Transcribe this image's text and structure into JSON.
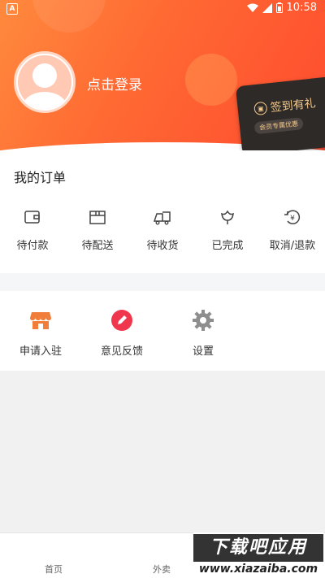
{
  "status_bar": {
    "left_icon_letter": "A",
    "time": "10:58"
  },
  "profile": {
    "login_text": "点击登录"
  },
  "vip_card": {
    "title": "签到有礼",
    "subtitle": "会员专属优惠"
  },
  "orders": {
    "title": "我的订单",
    "items": [
      {
        "label": "待付款",
        "icon": "wallet-icon"
      },
      {
        "label": "待配送",
        "icon": "package-icon"
      },
      {
        "label": "待收货",
        "icon": "delivery-truck-icon"
      },
      {
        "label": "已完成",
        "icon": "flower-icon"
      },
      {
        "label": "取消/退款",
        "icon": "refund-icon"
      }
    ]
  },
  "services": {
    "items": [
      {
        "label": "申请入驻",
        "icon": "store-icon",
        "color": "#f07d3a"
      },
      {
        "label": "意见反馈",
        "icon": "pencil-icon",
        "color": "#f0364c"
      },
      {
        "label": "设置",
        "icon": "gear-icon",
        "color": "#8e8e8e"
      }
    ]
  },
  "bottom_nav": {
    "items": [
      {
        "label": "首页"
      },
      {
        "label": "外卖"
      }
    ]
  },
  "watermark": {
    "main": "下载吧应用",
    "url": "www.xiazaiba.com"
  },
  "colors": {
    "header_start": "#ff8a3d",
    "header_end": "#ff4b2f",
    "vip_gold": "#f4c98a"
  }
}
